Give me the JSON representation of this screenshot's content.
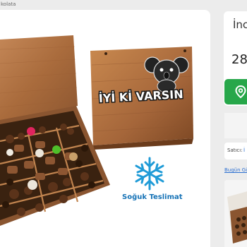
{
  "breadcrumb": "kolata",
  "sidebar": {
    "price_title": "İnci",
    "price": "28",
    "seller_label": "Satıcı:",
    "seller_value": "İ",
    "question_link": "Bugün Gü"
  },
  "product": {
    "box_lid_text": "İYİ Kİ VARSIN",
    "delivery_label": "Soğuk Teslimat"
  },
  "colors": {
    "wood": "#b8794a",
    "wood_dark": "#8a5530",
    "location_button": "#27a74a",
    "link": "#2c6fd1",
    "snowflake": "#1f9bd7"
  },
  "icons": [
    "location-pin-icon",
    "snowflake-icon",
    "koala-icon"
  ]
}
